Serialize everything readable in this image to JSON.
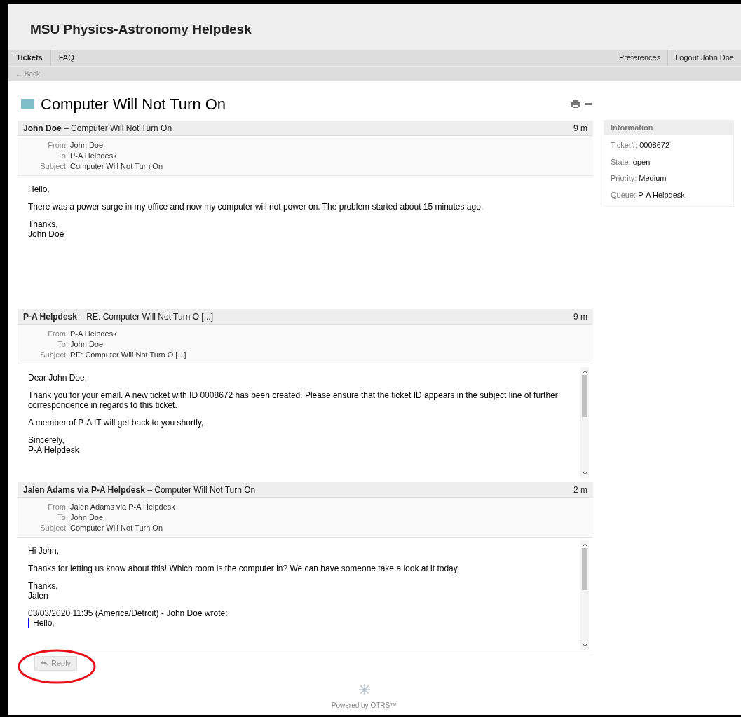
{
  "header": {
    "title": "MSU Physics-Astronomy Helpdesk"
  },
  "nav": {
    "left": [
      {
        "label": "Tickets",
        "selected": true
      },
      {
        "label": "FAQ",
        "selected": false
      }
    ],
    "right": [
      "Preferences",
      "Logout John Doe"
    ]
  },
  "back_link": "← Back",
  "ticket": {
    "title": "Computer Will Not Turn On"
  },
  "articles": [
    {
      "sender": "John Doe",
      "separator": "–",
      "subject": "Computer Will Not Turn On",
      "age": "9 m",
      "meta": [
        {
          "label": "From:",
          "value": "John Doe"
        },
        {
          "label": "To:",
          "value": "P-A Helpdesk"
        },
        {
          "label": "Subject:",
          "value": "Computer Will Not Turn On"
        }
      ],
      "scrollbar": false,
      "body": [
        {
          "kind": "text",
          "lines": [
            "Hello,"
          ]
        },
        {
          "kind": "text",
          "lines": [
            "There was a power surge in my office and now my computer will not power on. The problem started about 15 minutes ago."
          ]
        },
        {
          "kind": "text",
          "lines": [
            "Thanks,",
            "John Doe"
          ]
        }
      ]
    },
    {
      "sender": "P-A Helpdesk",
      "separator": "–",
      "subject": "RE: Computer Will Not Turn O [...]",
      "age": "9 m",
      "meta": [
        {
          "label": "From:",
          "value": "P-A Helpdesk"
        },
        {
          "label": "To:",
          "value": "John Doe"
        },
        {
          "label": "Subject:",
          "value": "RE: Computer Will Not Turn O [...]"
        }
      ],
      "scrollbar": true,
      "body": [
        {
          "kind": "text",
          "lines": [
            "Dear John Doe,"
          ]
        },
        {
          "kind": "text",
          "lines": [
            "Thank you for your email. A new ticket with ID 0008672 has been created. Please ensure that the ticket ID appears in the subject line of further",
            "correspondence in regards to this ticket."
          ]
        },
        {
          "kind": "text",
          "lines": [
            "A member of P-A IT will get back to you shortly,"
          ]
        },
        {
          "kind": "text",
          "lines": [
            "Sincerely,",
            "P-A Helpdesk"
          ]
        }
      ]
    },
    {
      "sender": "Jalen Adams via P-A Helpdesk",
      "separator": "–",
      "subject": "Computer Will Not Turn On",
      "age": "2 m",
      "meta": [
        {
          "label": "From:",
          "value": "Jalen Adams via P-A Helpdesk"
        },
        {
          "label": "To:",
          "value": "John Doe"
        },
        {
          "label": "Subject:",
          "value": "Computer Will Not Turn On"
        }
      ],
      "scrollbar": true,
      "body": [
        {
          "kind": "text",
          "lines": [
            "Hi John,"
          ]
        },
        {
          "kind": "text",
          "lines": [
            "Thanks for letting us know about this! Which room is the computer in? We can have someone take a look at it today."
          ]
        },
        {
          "kind": "text",
          "lines": [
            "Thanks,",
            "Jalen"
          ]
        },
        {
          "kind": "text",
          "lines": [
            "03/03/2020 11:35 (America/Detroit) - John Doe wrote:"
          ]
        },
        {
          "kind": "quote",
          "lines": [
            "Hello,"
          ]
        }
      ]
    }
  ],
  "reply_button": {
    "label": "Reply",
    "disabled": true
  },
  "info": {
    "title": "Information",
    "rows": [
      {
        "label": "Ticket#:",
        "value": "0008672"
      },
      {
        "label": "State:",
        "value": "open"
      },
      {
        "label": "Priority:",
        "value": "Medium"
      },
      {
        "label": "Queue:",
        "value": "P-A Helpdesk"
      }
    ]
  },
  "footer": {
    "text": "Powered by OTRS™"
  }
}
